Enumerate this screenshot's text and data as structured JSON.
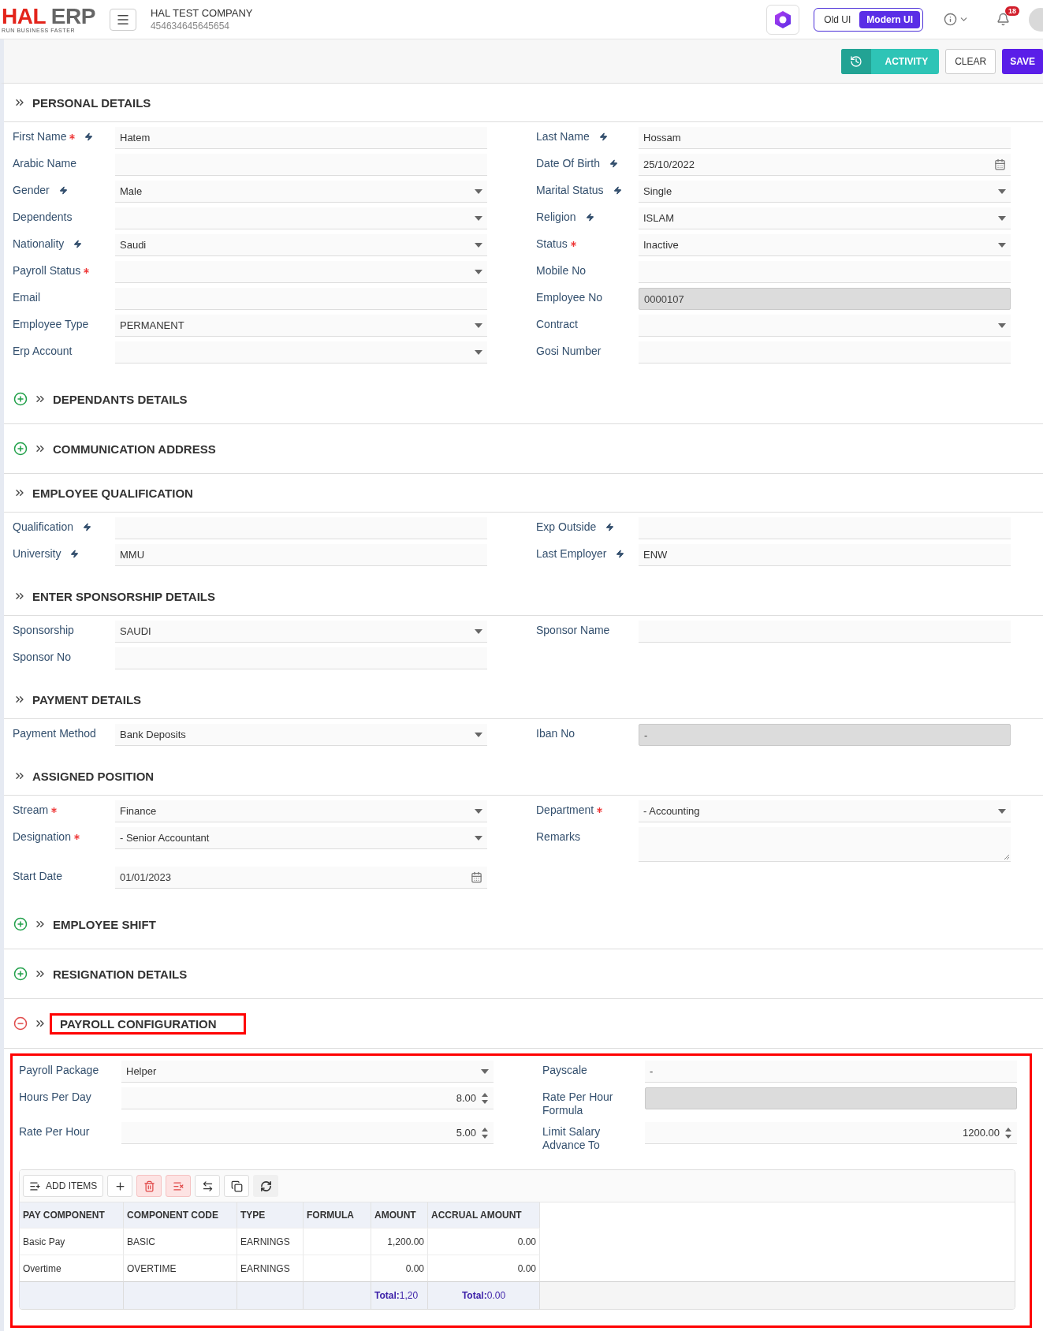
{
  "header": {
    "logo": {
      "primary": "HAL",
      "secondary": "ERP",
      "tagline": "RUN BUSINESS FASTER"
    },
    "company": {
      "name": "HAL TEST COMPANY",
      "code": "454634645645654"
    },
    "ui_switch": [
      {
        "label": "Old UI",
        "selected": false
      },
      {
        "label": "Modern UI",
        "selected": true
      }
    ],
    "notifications": {
      "count": "18"
    }
  },
  "toolbar": {
    "activity": "ACTIVITY",
    "clear": "CLEAR",
    "save": "SAVE"
  },
  "sections": [
    {
      "title": "PERSONAL DETAILS",
      "kind": "static",
      "expanded": true,
      "highlighted": false,
      "rows": [
        {
          "left": {
            "label": "First Name",
            "required": true,
            "quick": true,
            "kind": "text",
            "value": "Hatem"
          },
          "right": {
            "label": "Last Name",
            "required": false,
            "quick": true,
            "kind": "text",
            "value": "Hossam"
          }
        },
        {
          "left": {
            "label": "Arabic Name",
            "required": false,
            "quick": false,
            "kind": "text"
          },
          "right": {
            "label": "Date Of Birth",
            "required": false,
            "quick": true,
            "kind": "date",
            "value": "25/10/2022"
          }
        },
        {
          "left": {
            "label": "Gender",
            "required": false,
            "quick": true,
            "kind": "select",
            "value": "Male"
          },
          "right": {
            "label": "Marital Status",
            "required": false,
            "quick": true,
            "kind": "select",
            "value": "Single"
          }
        },
        {
          "left": {
            "label": "Dependents",
            "required": false,
            "quick": false,
            "kind": "select"
          },
          "right": {
            "label": "Religion",
            "required": false,
            "quick": true,
            "kind": "select",
            "value": "ISLAM"
          }
        },
        {
          "left": {
            "label": "Nationality",
            "required": false,
            "quick": true,
            "kind": "select",
            "value": "Saudi"
          },
          "right": {
            "label": "Status",
            "required": true,
            "quick": false,
            "kind": "select",
            "value": "Inactive"
          }
        },
        {
          "left": {
            "label": "Payroll Status",
            "required": true,
            "quick": false,
            "kind": "select"
          },
          "right": {
            "label": "Mobile No",
            "required": false,
            "quick": false,
            "kind": "text"
          }
        },
        {
          "left": {
            "label": "Email",
            "required": false,
            "quick": false,
            "kind": "text"
          },
          "right": {
            "label": "Employee No",
            "required": false,
            "quick": false,
            "kind": "readonly",
            "value": "0000107"
          }
        },
        {
          "left": {
            "label": "Employee Type",
            "required": false,
            "quick": false,
            "kind": "select",
            "value": "PERMANENT"
          },
          "right": {
            "label": "Contract",
            "required": false,
            "quick": false,
            "kind": "select"
          }
        },
        {
          "left": {
            "label": "Erp Account",
            "required": false,
            "quick": false,
            "kind": "select"
          },
          "right": {
            "label": "Gosi Number",
            "required": false,
            "quick": false,
            "kind": "text"
          }
        }
      ]
    },
    {
      "title": "DEPENDANTS DETAILS",
      "kind": "collapsible",
      "expanded": false,
      "highlighted": false
    },
    {
      "title": "COMMUNICATION ADDRESS",
      "kind": "collapsible",
      "expanded": false,
      "highlighted": false
    },
    {
      "title": "EMPLOYEE QUALIFICATION",
      "kind": "static",
      "expanded": true,
      "highlighted": false,
      "rows": [
        {
          "left": {
            "label": "Qualification",
            "required": false,
            "quick": true,
            "kind": "text"
          },
          "right": {
            "label": "Exp Outside",
            "required": false,
            "quick": true,
            "kind": "text"
          }
        },
        {
          "left": {
            "label": "University",
            "required": false,
            "quick": true,
            "kind": "text",
            "value": "MMU"
          },
          "right": {
            "label": "Last Employer",
            "required": false,
            "quick": true,
            "kind": "text",
            "value": "ENW"
          }
        }
      ]
    },
    {
      "title": "ENTER SPONSORSHIP DETAILS",
      "kind": "static",
      "expanded": true,
      "highlighted": false,
      "rows": [
        {
          "left": {
            "label": "Sponsorship",
            "required": false,
            "quick": false,
            "kind": "select",
            "value": "SAUDI"
          },
          "right": {
            "label": "Sponsor Name",
            "required": false,
            "quick": false,
            "kind": "text"
          }
        },
        {
          "left": {
            "label": "Sponsor No",
            "required": false,
            "quick": false,
            "kind": "text"
          }
        }
      ]
    },
    {
      "title": "PAYMENT DETAILS",
      "kind": "static",
      "expanded": true,
      "highlighted": false,
      "rows": [
        {
          "left": {
            "label": "Payment Method",
            "required": false,
            "quick": false,
            "kind": "select",
            "value": "Bank Deposits"
          },
          "right": {
            "label": "Iban No",
            "required": false,
            "quick": false,
            "kind": "readonly",
            "value": "-"
          }
        }
      ]
    },
    {
      "title": "ASSIGNED POSITION",
      "kind": "static",
      "expanded": true,
      "highlighted": false,
      "rows": [
        {
          "left": {
            "label": "Stream",
            "required": true,
            "quick": false,
            "kind": "select",
            "value": "Finance"
          },
          "right": {
            "label": "Department",
            "required": true,
            "quick": false,
            "kind": "select",
            "value": "- Accounting"
          }
        },
        {
          "left": {
            "label": "Designation",
            "required": true,
            "quick": false,
            "kind": "select",
            "value": "- Senior Accountant"
          },
          "right": {
            "label": "Remarks",
            "required": false,
            "quick": false,
            "kind": "textarea"
          }
        },
        {
          "left": {
            "label": "Start Date",
            "required": false,
            "quick": false,
            "kind": "date",
            "value": "01/01/2023"
          }
        }
      ]
    },
    {
      "title": "EMPLOYEE SHIFT",
      "kind": "collapsible",
      "expanded": false,
      "highlighted": false
    },
    {
      "title": "RESIGNATION DETAILS",
      "kind": "collapsible",
      "expanded": false,
      "highlighted": false
    },
    {
      "title": "PAYROLL CONFIGURATION",
      "kind": "collapsible",
      "expanded": true,
      "highlighted": true,
      "rows": [
        {
          "left": {
            "label": "Payroll Package",
            "required": false,
            "quick": false,
            "kind": "select",
            "value": "Helper"
          },
          "right": {
            "label": "Payscale",
            "required": false,
            "quick": false,
            "kind": "text",
            "value": "-"
          }
        },
        {
          "left": {
            "label": "Hours Per Day",
            "required": false,
            "quick": false,
            "kind": "number",
            "value": "8.00"
          },
          "right": {
            "label": "Rate Per Hour Formula",
            "required": false,
            "quick": false,
            "kind": "readonly"
          }
        },
        {
          "left": {
            "label": "Rate Per Hour",
            "required": false,
            "quick": false,
            "kind": "number",
            "value": "5.00"
          },
          "right": {
            "label": "Limit Salary Advance To",
            "required": false,
            "quick": false,
            "kind": "number",
            "value": "1200.00"
          }
        }
      ],
      "table": {
        "add_items": "ADD ITEMS",
        "columns": [
          "PAY COMPONENT",
          "COMPONENT CODE",
          "TYPE",
          "FORMULA",
          "AMOUNT",
          "ACCRUAL AMOUNT"
        ],
        "rows": [
          [
            "Basic Pay",
            "BASIC",
            "EARNINGS",
            null,
            "1,200.00",
            "0.00"
          ],
          [
            "Overtime",
            "OVERTIME",
            "EARNINGS",
            null,
            "0.00",
            "0.00"
          ]
        ],
        "totals": {
          "amount": "**Total:**1,20",
          "accrual_amount": "**Total:**0.00"
        }
      }
    }
  ]
}
